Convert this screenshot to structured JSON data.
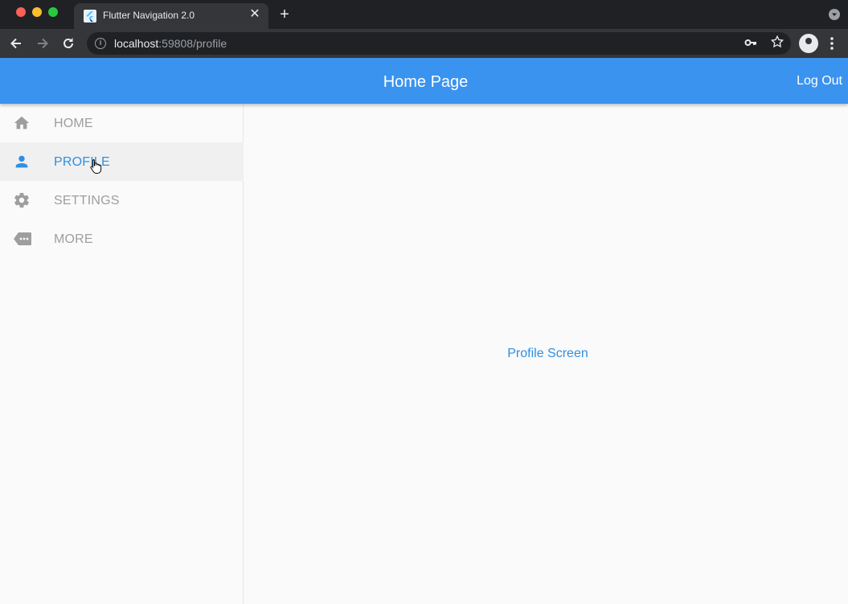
{
  "browser": {
    "tab_title": "Flutter Navigation 2.0",
    "tab_close": "✕",
    "new_tab": "+",
    "url_host": "localhost",
    "url_rest": ":59808/profile"
  },
  "appbar": {
    "title": "Home Page",
    "logout_label": "Log Out"
  },
  "sidebar": {
    "items": [
      {
        "label": "HOME",
        "icon": "home-icon",
        "color": "#9e9e9e"
      },
      {
        "label": "PROFILE",
        "icon": "person-icon",
        "color": "#2f8fe3",
        "active": true
      },
      {
        "label": "SETTINGS",
        "icon": "gear-icon",
        "color": "#9e9e9e"
      },
      {
        "label": "MORE",
        "icon": "more-tag-icon",
        "color": "#9e9e9e"
      }
    ]
  },
  "content": {
    "text": "Profile Screen"
  },
  "colors": {
    "accent": "#3a93ee",
    "active_text": "#2f8fe3",
    "inactive": "#9e9e9e"
  }
}
